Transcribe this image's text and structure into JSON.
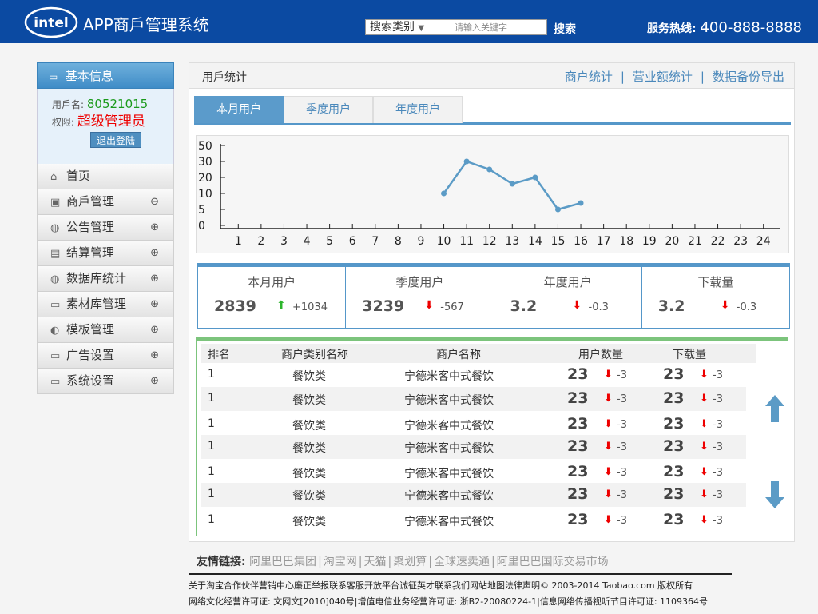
{
  "header": {
    "logo_text": "intel",
    "app_title": "APP商戶管理系统",
    "search_category": "搜索类别",
    "search_placeholder": "请输入关键字",
    "search_button": "搜索",
    "hotline_label": "服务热线:",
    "hotline_number": "400-888-8888"
  },
  "sidebar": {
    "heading": "基本信息",
    "user_label": "用戶名:",
    "user_value": "80521015",
    "role_label": "权限:",
    "role_value": "超级管理员",
    "logout": "退出登陆",
    "items": [
      {
        "label": "首页",
        "toggle": ""
      },
      {
        "label": "商戶管理",
        "toggle": "⊖"
      },
      {
        "label": "公告管理",
        "toggle": "⊕"
      },
      {
        "label": "结算管理",
        "toggle": "⊕"
      },
      {
        "label": "数据库统计",
        "toggle": "⊕"
      },
      {
        "label": "素材库管理",
        "toggle": "⊕"
      },
      {
        "label": "模板管理",
        "toggle": "⊕"
      },
      {
        "label": "广告设置",
        "toggle": "⊕"
      },
      {
        "label": "系统设置",
        "toggle": "⊕"
      }
    ]
  },
  "main": {
    "title": "用戶统计",
    "links": [
      "商户统计",
      "营业额统计",
      "数据备份导出"
    ],
    "tabs": [
      "本月用户",
      "季度用户",
      "年度用户"
    ]
  },
  "chart_data": {
    "type": "line",
    "x": [
      1,
      2,
      3,
      4,
      5,
      6,
      7,
      8,
      9,
      10,
      11,
      12,
      13,
      14,
      15,
      16,
      17,
      18,
      19,
      20,
      21,
      22,
      23,
      24
    ],
    "series": [
      {
        "x": [
          10,
          11,
          12,
          13,
          14,
          15,
          16
        ],
        "values": [
          10,
          30,
          25,
          16,
          20,
          5,
          7
        ]
      }
    ],
    "yticks": [
      0,
      5,
      10,
      20,
      30,
      50
    ],
    "ylim": [
      0,
      50
    ],
    "xlabel": "",
    "ylabel": "",
    "color": "#5b9bc6"
  },
  "stats": [
    {
      "label": "本月用户",
      "value": "2839",
      "dir": "up",
      "change": "+1034"
    },
    {
      "label": "季度用户",
      "value": "3239",
      "dir": "down",
      "change": "-567"
    },
    {
      "label": "年度用户",
      "value": "3.2",
      "dir": "down",
      "change": "-0.3"
    },
    {
      "label": "下载量",
      "value": "3.2",
      "dir": "down",
      "change": "-0.3"
    }
  ],
  "table": {
    "headers": [
      "排名",
      "商户类别名称",
      "商户名称",
      "用户数量",
      "下载量"
    ],
    "rows": [
      {
        "rank": "1",
        "category": "餐饮类",
        "name": "宁德米客中式餐饮",
        "users": "23",
        "users_change": "-3",
        "downloads": "23",
        "downloads_change": "-3"
      },
      {
        "rank": "1",
        "category": "餐饮类",
        "name": "宁德米客中式餐饮",
        "users": "23",
        "users_change": "-3",
        "downloads": "23",
        "downloads_change": "-3"
      },
      {
        "rank": "1",
        "category": "餐饮类",
        "name": "宁德米客中式餐饮",
        "users": "23",
        "users_change": "-3",
        "downloads": "23",
        "downloads_change": "-3"
      },
      {
        "rank": "1",
        "category": "餐饮类",
        "name": "宁德米客中式餐饮",
        "users": "23",
        "users_change": "-3",
        "downloads": "23",
        "downloads_change": "-3"
      },
      {
        "rank": "1",
        "category": "餐饮类",
        "name": "宁德米客中式餐饮",
        "users": "23",
        "users_change": "-3",
        "downloads": "23",
        "downloads_change": "-3"
      },
      {
        "rank": "1",
        "category": "餐饮类",
        "name": "宁德米客中式餐饮",
        "users": "23",
        "users_change": "-3",
        "downloads": "23",
        "downloads_change": "-3"
      },
      {
        "rank": "1",
        "category": "餐饮类",
        "name": "宁德米客中式餐饮",
        "users": "23",
        "users_change": "-3",
        "downloads": "23",
        "downloads_change": "-3"
      }
    ]
  },
  "friends": {
    "label": "友情链接:",
    "links": [
      "阿里巴巴集团",
      "淘宝网",
      "天猫",
      "聚划算",
      "全球速卖通",
      "阿里巴巴国际交易市场"
    ]
  },
  "footer": {
    "line1": "关于淘宝合作伙伴营销中心廉正举报联系客服开放平台诚征英才联系我们网站地图法律声明© 2003-2014 Taobao.com 版权所有",
    "line2": "网络文化经营许可证: 文网文[2010]040号|增值电信业务经营许可证: 浙B2-20080224-1|信息网络传播视听节目许可证: 1109364号"
  },
  "colors": {
    "header_bg": "#0b4aa2",
    "accent": "#5597c9",
    "table_accent": "#7cc47c",
    "up": "#2cb52c",
    "down": "#e00000"
  }
}
